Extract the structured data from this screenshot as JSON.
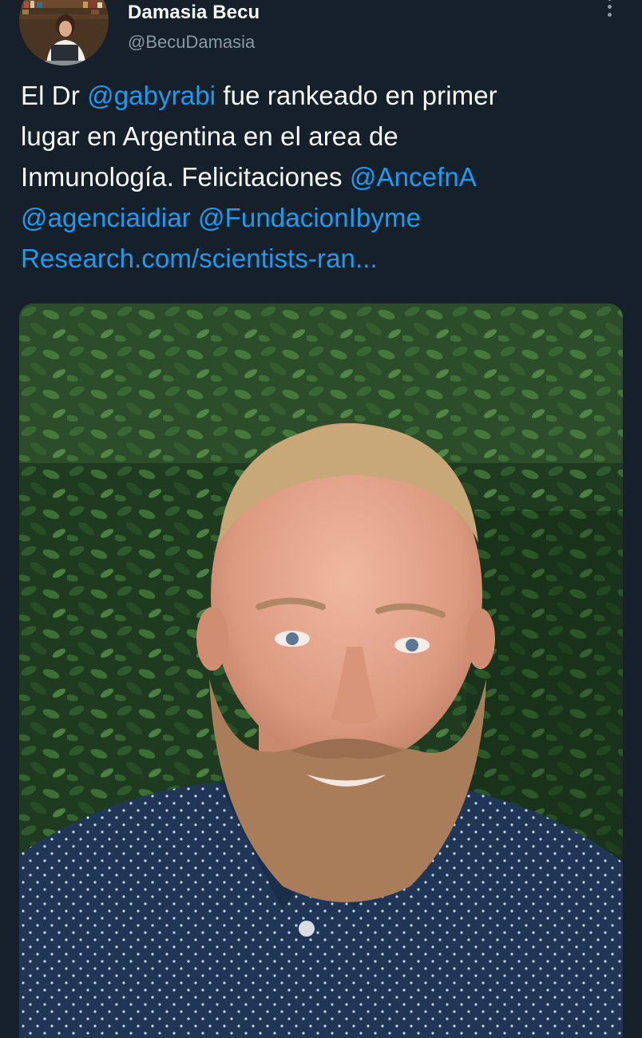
{
  "tweet": {
    "author": {
      "name": "Damasia Becu",
      "handle": "@BecuDamasia"
    },
    "text": {
      "line1_a": "El Dr ",
      "mention_gabyrabi": "@gabyrabi",
      "line1_b": " fue rankeado en primer",
      "line2": "lugar en Argentina en el area de",
      "line3_a": "Inmunología. Felicitaciones ",
      "mention_ancefna": "@AncefnA",
      "mention_agenciaidiar": "@agenciaidiar",
      "line4_space": " ",
      "mention_fundacionibyme": "@FundacionIbyme",
      "link_research": "Research.com/scientists-ran..."
    }
  },
  "icons": {
    "more": "more-vertical-icon"
  },
  "colors": {
    "background": "#15202b",
    "text": "#f7f9f9",
    "secondary_text": "#8b98a5",
    "link": "#1d9bf0"
  }
}
